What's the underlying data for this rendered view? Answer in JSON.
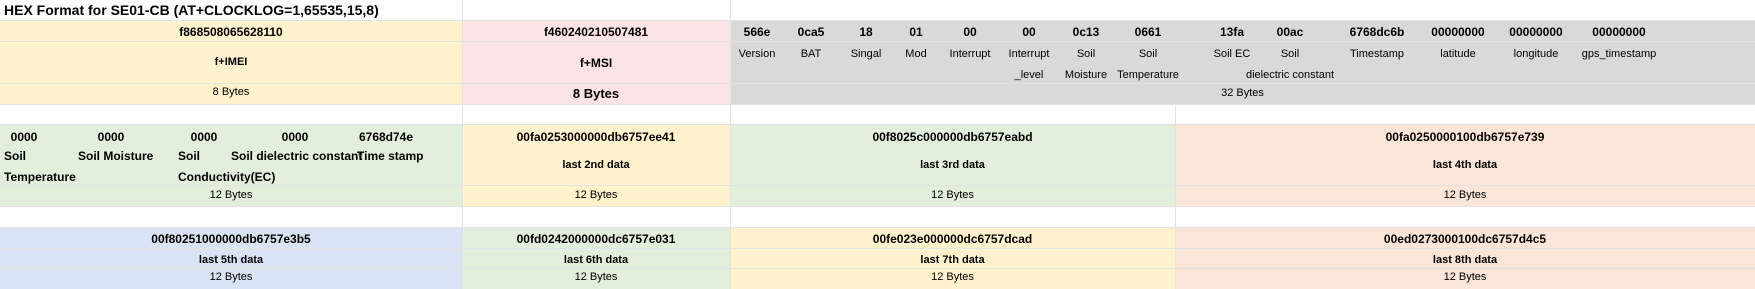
{
  "title": "HEX Format for SE01-CB (AT+CLOCKLOG=1,65535,15,8)",
  "row1": {
    "imei": {
      "hex": "f868508065628110",
      "label": "f+IMEI",
      "size": "8 Bytes"
    },
    "imsi": {
      "hex": "f460240210507481",
      "label": "f+MSI",
      "size": "8 Bytes"
    },
    "fields": [
      {
        "hex": "566e",
        "l1": "Version",
        "l2": ""
      },
      {
        "hex": "0ca5",
        "l1": "BAT",
        "l2": ""
      },
      {
        "hex": "18",
        "l1": "Singal",
        "l2": ""
      },
      {
        "hex": "01",
        "l1": "Mod",
        "l2": ""
      },
      {
        "hex": "00",
        "l1": "Interrupt",
        "l2": ""
      },
      {
        "hex": "00",
        "l1": "Interrupt",
        "l2": "_level"
      },
      {
        "hex": "0c13",
        "l1": "Soil",
        "l2": "Moisture"
      },
      {
        "hex": "0661",
        "l1": "Soil",
        "l2": "Temperature"
      },
      {
        "hex": "13fa",
        "l1": "Soil EC",
        "l2": ""
      },
      {
        "hex": "00ac",
        "l1": "Soil",
        "l2": "dielectric constant"
      },
      {
        "hex": "6768dc6b",
        "l1": "Timestamp",
        "l2": ""
      },
      {
        "hex": "00000000",
        "l1": "latitude",
        "l2": ""
      },
      {
        "hex": "00000000",
        "l1": "longitude",
        "l2": ""
      },
      {
        "hex": "00000000",
        "l1": "gps_timestamp",
        "l2": ""
      }
    ],
    "main_size": "32 Bytes"
  },
  "row2": {
    "first": {
      "hexes": [
        "0000",
        "0000",
        "0000",
        "0000",
        "6768d74e"
      ],
      "labels": [
        "Soil",
        "Soil Moisture",
        "Soil",
        "Soil dielectric constant",
        "Time stamp"
      ],
      "labels2": [
        "Temperature",
        "Conductivity(EC)"
      ],
      "size": "12 Bytes"
    },
    "blocks": [
      {
        "hex": "00fa0253000000db6757ee41",
        "label": "last 2nd data",
        "size": "12 Bytes"
      },
      {
        "hex": "00f8025c000000db6757eabd",
        "label": "last 3rd data",
        "size": "12 Bytes"
      },
      {
        "hex": "00fa0250000100db6757e739",
        "label": "last 4th data",
        "size": "12 Bytes"
      }
    ]
  },
  "row3": {
    "blocks": [
      {
        "hex": "00f80251000000db6757e3b5",
        "label": "last 5th data",
        "size": "12 Bytes"
      },
      {
        "hex": "00fd0242000000dc6757e031",
        "label": "last 6th data",
        "size": "12 Bytes"
      },
      {
        "hex": "00fe023e000000dc6757dcad",
        "label": "last 7th data",
        "size": "12 Bytes"
      },
      {
        "hex": "00ed0273000100dc6757d4c5",
        "label": "last 8th data",
        "size": "12 Bytes"
      }
    ]
  }
}
